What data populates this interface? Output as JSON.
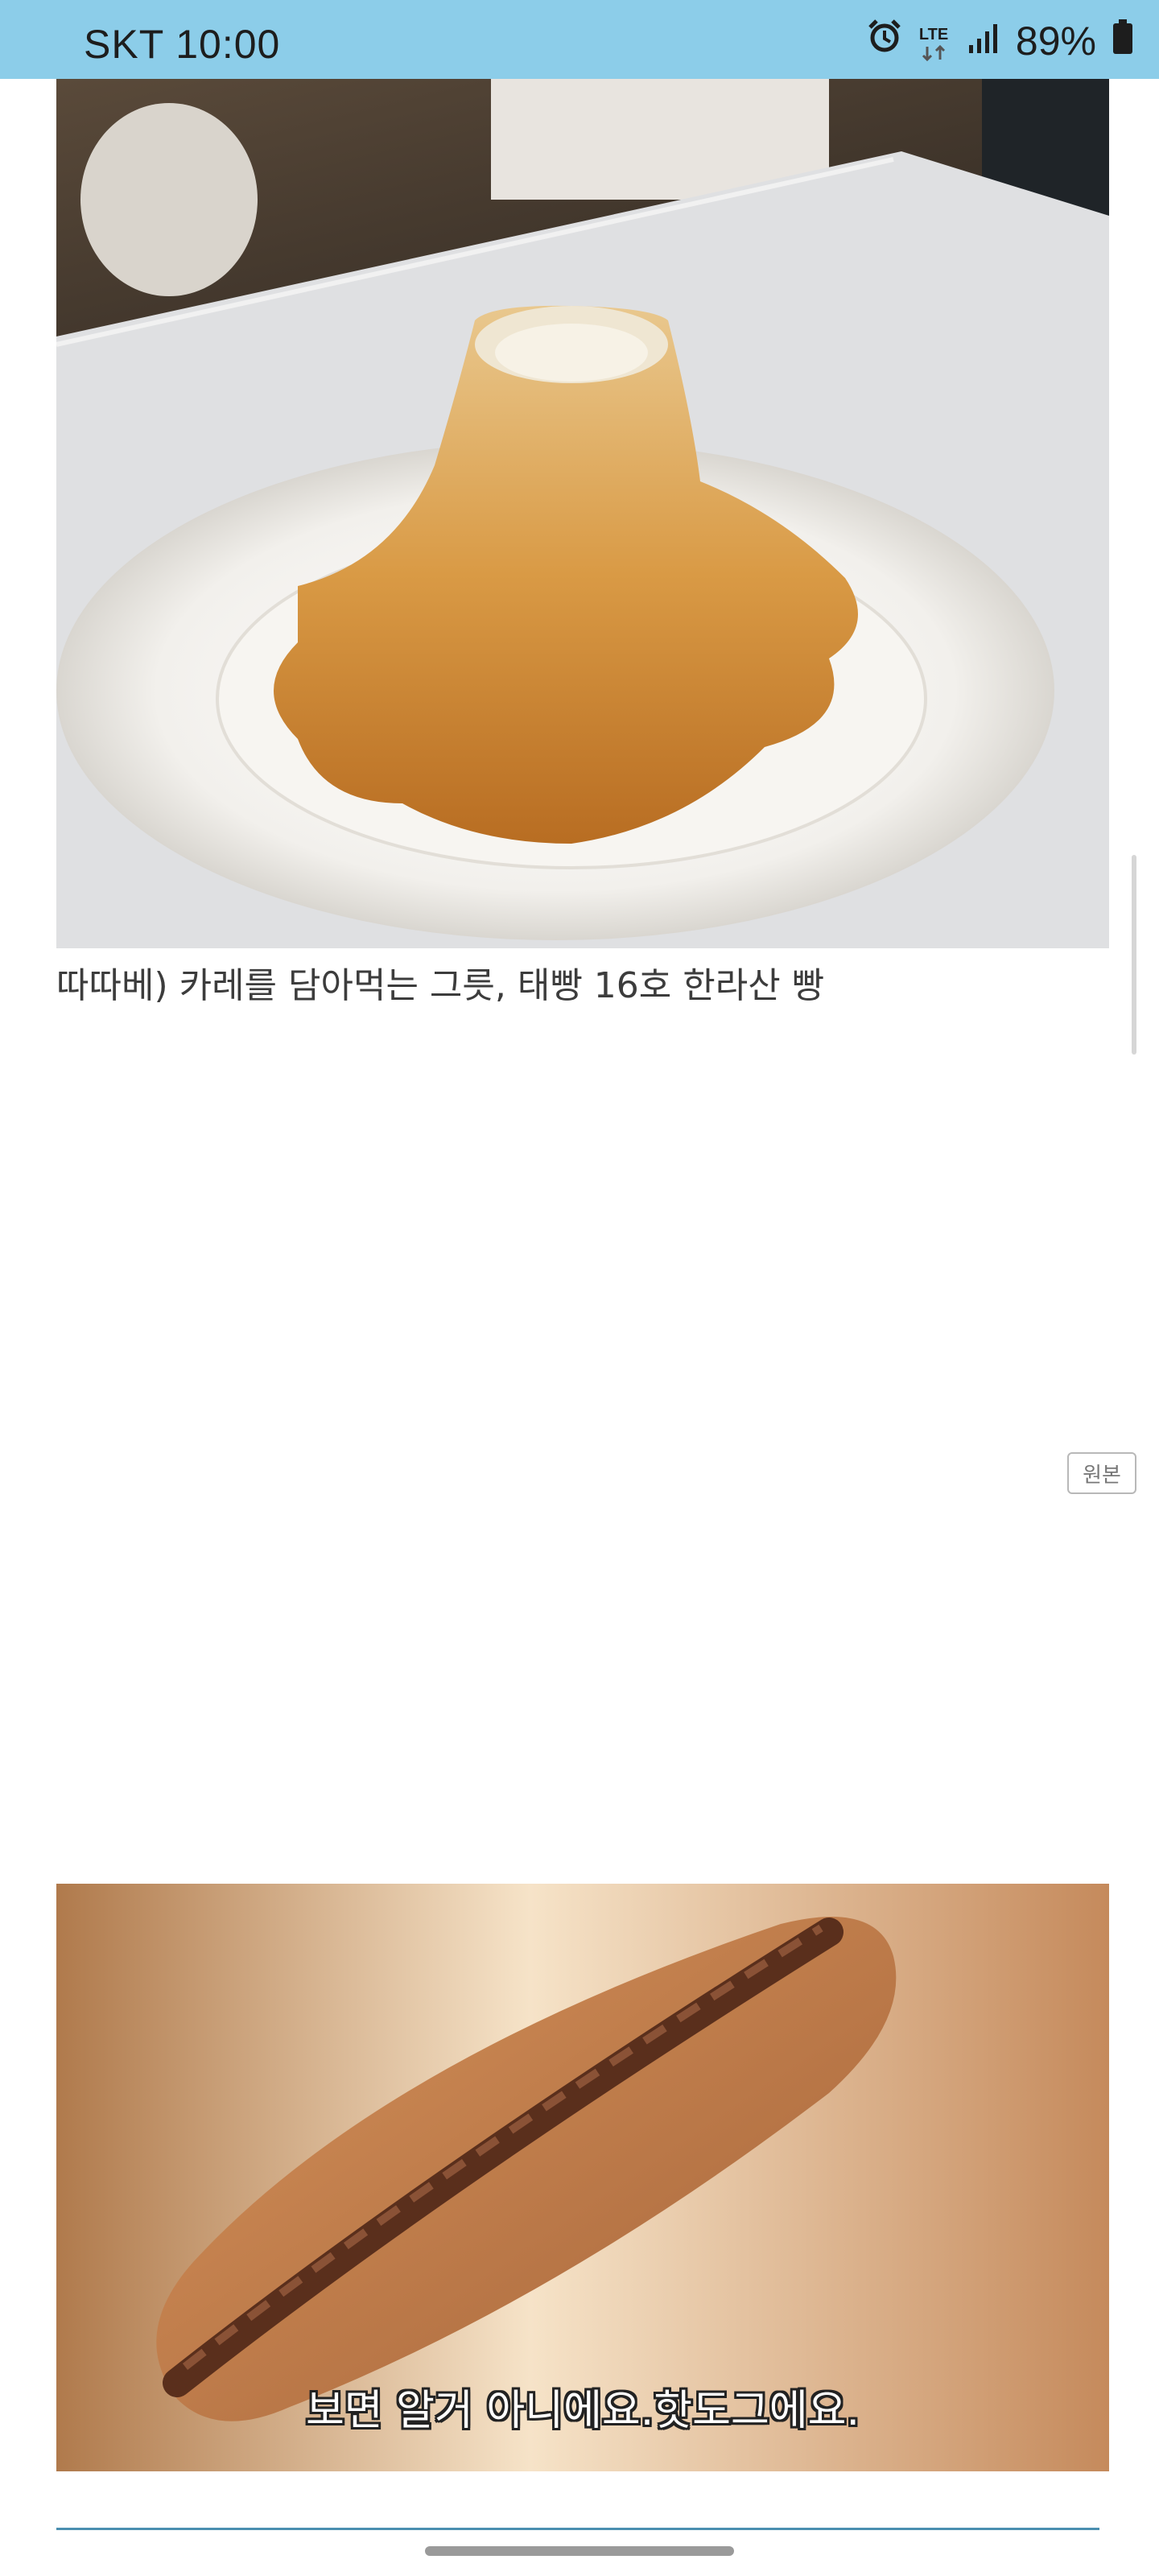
{
  "status_bar": {
    "carrier_time": "SKT 10:00",
    "network": "LTE",
    "battery": "89%"
  },
  "post": {
    "caption": "따따베) 카레를 담아먹는 그릇, 태빵 16호 한라산 빵",
    "original_button": "원본",
    "hotdog_subtitle": "보면 알거 아니에요.핫도그에요."
  }
}
